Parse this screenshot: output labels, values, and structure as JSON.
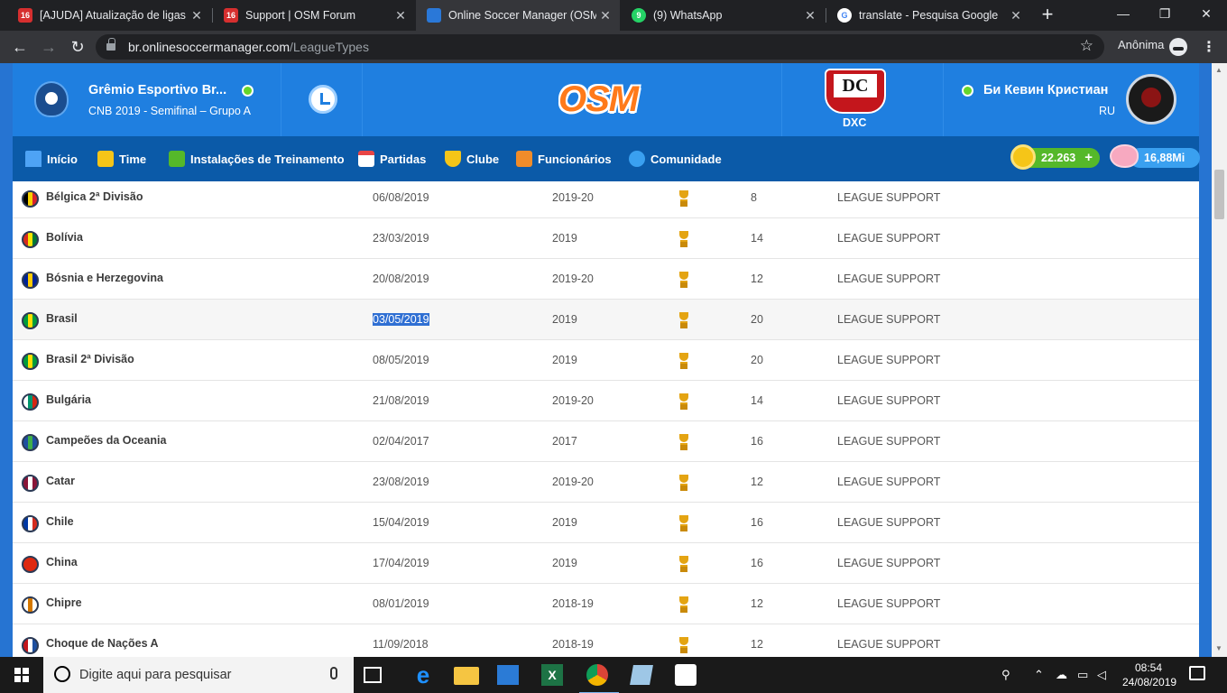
{
  "browser": {
    "tabs": [
      {
        "title": "[AJUDA] Atualização de ligas |",
        "badge": "16",
        "color": "#d62f2f"
      },
      {
        "title": "Support | OSM Forum",
        "badge": "16",
        "color": "#d62f2f"
      },
      {
        "title": "Online Soccer Manager (OSM)",
        "badge": "",
        "color": "#2a78d8"
      },
      {
        "title": "(9) WhatsApp",
        "badge": "9",
        "color": "#25d366"
      },
      {
        "title": "translate - Pesquisa Google",
        "badge": "G",
        "color": "#ffffff"
      }
    ],
    "url_host": "br.onlinesoccermanager.com",
    "url_path": "/LeagueTypes",
    "profile_label": "Anônima"
  },
  "club": {
    "name": "Grêmio Esportivo Br...",
    "subtitle": "CNB 2019 - Semifinal – Grupo A"
  },
  "logo_text": "OSM",
  "rival": {
    "crest_text": "DC",
    "label": "DXC"
  },
  "manager": {
    "name": "Би Кевин Кристиан",
    "country": "RU"
  },
  "nav": [
    {
      "label": "Início",
      "icon": "home-icon",
      "color": "#4ea3f5"
    },
    {
      "label": "Time",
      "icon": "shirt-icon",
      "color": "#f5c518"
    },
    {
      "label": "Instalações de Treinamento",
      "icon": "training-field-icon",
      "color": "#55b82a"
    },
    {
      "label": "Partidas",
      "icon": "calendar-icon",
      "color": "#e84545"
    },
    {
      "label": "Clube",
      "icon": "shield-icon",
      "color": "#f5c518"
    },
    {
      "label": "Funcionários",
      "icon": "staff-icon",
      "color": "#f08c2a"
    },
    {
      "label": "Comunidade",
      "icon": "globe-icon",
      "color": "#3aa0f0"
    }
  ],
  "currency": {
    "gold": "22.263",
    "plus": "+",
    "cash": "16,88Mi"
  },
  "leagues": [
    {
      "country": "Bélgica 2ª Divisão",
      "date": "06/08/2019",
      "season": "2019-20",
      "teams": "8",
      "creator": "LEAGUE SUPPORT",
      "flag": [
        "#000000",
        "#f5d000",
        "#d8222a"
      ]
    },
    {
      "country": "Bolívia",
      "date": "23/03/2019",
      "season": "2019",
      "teams": "14",
      "creator": "LEAGUE SUPPORT",
      "flag": [
        "#d52b1e",
        "#f9e300",
        "#007934"
      ]
    },
    {
      "country": "Bósnia e Herzegovina",
      "date": "20/08/2019",
      "season": "2019-20",
      "teams": "12",
      "creator": "LEAGUE SUPPORT",
      "flag": [
        "#002395",
        "#fecb00",
        "#002395"
      ]
    },
    {
      "country": "Brasil",
      "date": "03/05/2019",
      "season": "2019",
      "teams": "20",
      "creator": "LEAGUE SUPPORT",
      "flag": [
        "#009c3b",
        "#ffdf00",
        "#009c3b"
      ],
      "selected": true
    },
    {
      "country": "Brasil 2ª Divisão",
      "date": "08/05/2019",
      "season": "2019",
      "teams": "20",
      "creator": "LEAGUE SUPPORT",
      "flag": [
        "#009c3b",
        "#ffdf00",
        "#009c3b"
      ]
    },
    {
      "country": "Bulgária",
      "date": "21/08/2019",
      "season": "2019-20",
      "teams": "14",
      "creator": "LEAGUE SUPPORT",
      "flag": [
        "#ffffff",
        "#00966e",
        "#d62612"
      ]
    },
    {
      "country": "Campeões da Oceania",
      "date": "02/04/2017",
      "season": "2017",
      "teams": "16",
      "creator": "LEAGUE SUPPORT",
      "flag": [
        "#1d4fa0",
        "#3fae49",
        "#1d4fa0"
      ]
    },
    {
      "country": "Catar",
      "date": "23/08/2019",
      "season": "2019-20",
      "teams": "12",
      "creator": "LEAGUE SUPPORT",
      "flag": [
        "#8a1538",
        "#ffffff",
        "#8a1538"
      ]
    },
    {
      "country": "Chile",
      "date": "15/04/2019",
      "season": "2019",
      "teams": "16",
      "creator": "LEAGUE SUPPORT",
      "flag": [
        "#0039a6",
        "#ffffff",
        "#d52b1e"
      ]
    },
    {
      "country": "China",
      "date": "17/04/2019",
      "season": "2019",
      "teams": "16",
      "creator": "LEAGUE SUPPORT",
      "flag": [
        "#de2910",
        "#de2910",
        "#de2910"
      ]
    },
    {
      "country": "Chipre",
      "date": "08/01/2019",
      "season": "2018-19",
      "teams": "12",
      "creator": "LEAGUE SUPPORT",
      "flag": [
        "#ffffff",
        "#d57800",
        "#ffffff"
      ]
    },
    {
      "country": "Choque de Nações A",
      "date": "11/09/2018",
      "season": "2018-19",
      "teams": "12",
      "creator": "LEAGUE SUPPORT",
      "flag": [
        "#c4161c",
        "#ffffff",
        "#1d4fa0"
      ]
    }
  ],
  "taskbar": {
    "search_placeholder": "Digite aqui para pesquisar",
    "time": "08:54",
    "date": "24/08/2019"
  }
}
